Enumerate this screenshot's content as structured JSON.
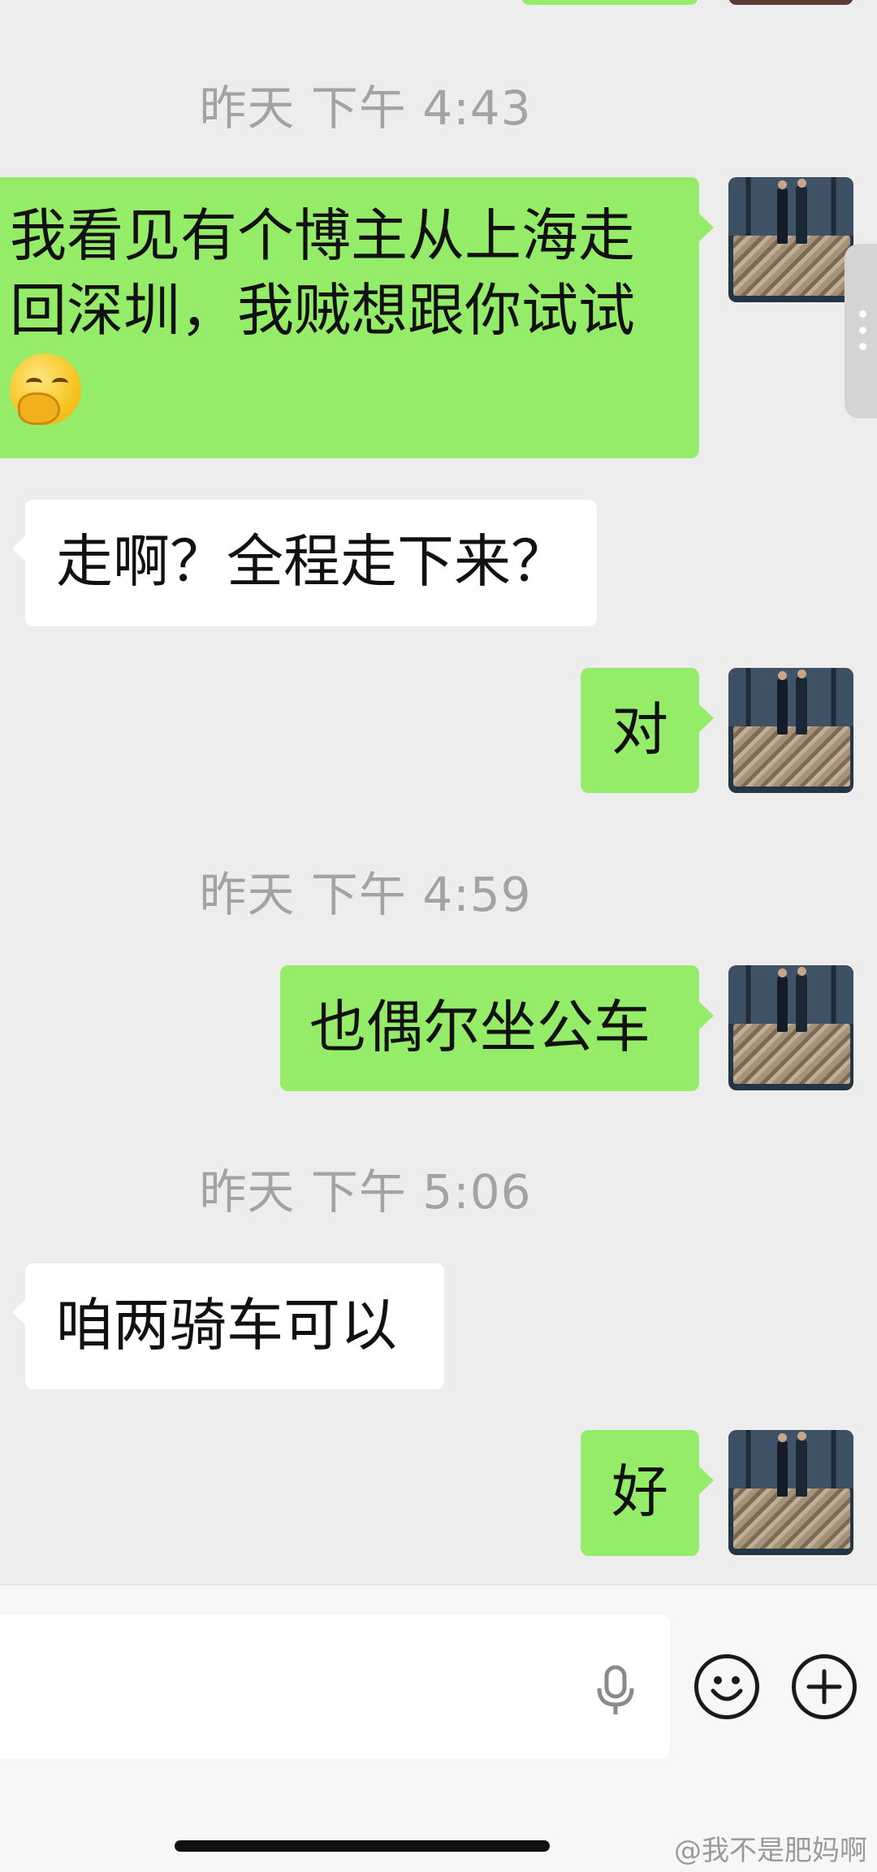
{
  "timestamps": [
    "昨天 下午 4:43",
    "昨天 下午 4:59",
    "昨天 下午 5:06"
  ],
  "messages": [
    {
      "from": "me",
      "lines": [
        "我看见有个博主从上海走",
        "回深圳，我贼想跟你试试"
      ],
      "emoji": "thinking-face"
    },
    {
      "from": "them",
      "text": "走啊？全程走下来？"
    },
    {
      "from": "me",
      "text": "对"
    },
    {
      "from": "me",
      "text": "也偶尔坐公车"
    },
    {
      "from": "them",
      "text": "咱两骑车可以"
    },
    {
      "from": "me",
      "text": "好"
    }
  ],
  "input": {
    "placeholder": ""
  },
  "icons": {
    "mic": "microphone-icon",
    "emoji": "smiley-icon",
    "more": "plus-icon"
  },
  "watermark": "@我不是肥妈啊",
  "colors": {
    "background": "#ededed",
    "my_bubble": "#95ec69",
    "their_bubble": "#ffffff",
    "timestamp": "#a3a3a3"
  }
}
